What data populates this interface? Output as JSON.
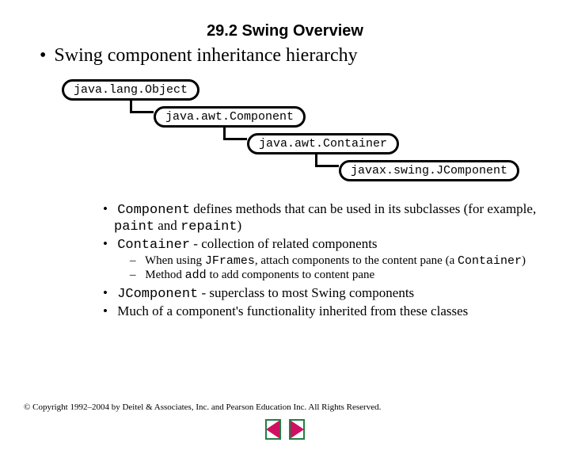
{
  "title": "29.2  Swing Overview",
  "main_bullet": "Swing component inheritance hierarchy",
  "classes": {
    "c0": "java.lang.Object",
    "c1": "java.awt.Component",
    "c2": "java.awt.Container",
    "c3": "javax.swing.JComponent"
  },
  "bullets_a": {
    "b1_pre": "Component",
    "b1_mid": " defines methods that can be used in its subclasses (for example, ",
    "b1_m1": "paint",
    "b1_and": " and ",
    "b1_m2": "repaint",
    "b1_post": ")",
    "b2_pre": "Container",
    "b2_post": " - collection of related components"
  },
  "subbullets": {
    "s1_pre": "When using ",
    "s1_code": "JFrames",
    "s1_mid": ", attach components to the content pane (a ",
    "s1_code2": "Container",
    "s1_post": ")",
    "s2_pre": "Method ",
    "s2_code": "add",
    "s2_post": " to add components to content pane"
  },
  "bullets_b": {
    "b3_pre": "JComponent",
    "b3_post": " - superclass to most Swing components",
    "b4": "Much of a component's functionality inherited from these classes"
  },
  "copyright": "© Copyright 1992–2004 by Deitel & Associates, Inc. and Pearson Education Inc. All Rights Reserved."
}
